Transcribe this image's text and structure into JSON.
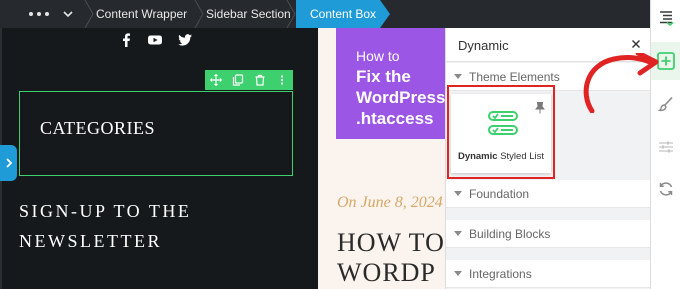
{
  "breadcrumb": {
    "more_icon": "more-horizontal-icon",
    "dropdown_icon": "chevron-down-icon",
    "items": [
      "Content Wrapper",
      "Sidebar Section",
      "Content Box"
    ],
    "active_index": 2
  },
  "canvas_left": {
    "social_icons": [
      "facebook-icon",
      "youtube-icon",
      "twitter-icon"
    ],
    "toolbar_icons": [
      "move-icon",
      "duplicate-icon",
      "delete-icon",
      "more-vertical-icon"
    ],
    "widget_title": "CATEGORIES",
    "signup_heading": "SIGN-UP TO THE NEWSLETTER"
  },
  "canvas_right": {
    "hero_line1": "How to",
    "hero_line2": "Fix the",
    "hero_line3": "WordPress",
    "hero_line4": ".htaccess",
    "post_date": "On June 8, 2024",
    "post_title_line1": "HOW TO",
    "post_title_line2": "WORDP"
  },
  "panel": {
    "search_value": "Dynamic",
    "sections": [
      "Theme Elements",
      "Foundation",
      "Building Blocks",
      "Integrations"
    ],
    "element_card": {
      "label_bold": "Dynamic",
      "label_rest": " Styled List",
      "icon": "styled-list-icon"
    }
  },
  "rail": {
    "icons": [
      "navigator-icon",
      "add-element-icon",
      "brush-icon",
      "sliders-icon",
      "sync-icon"
    ]
  },
  "colors": {
    "accent_blue": "#1f9bd7",
    "accent_green": "#3ecf6e",
    "highlight_red": "#e02424",
    "hero_purple": "#9b56e6",
    "date_gold": "#d6a767"
  }
}
